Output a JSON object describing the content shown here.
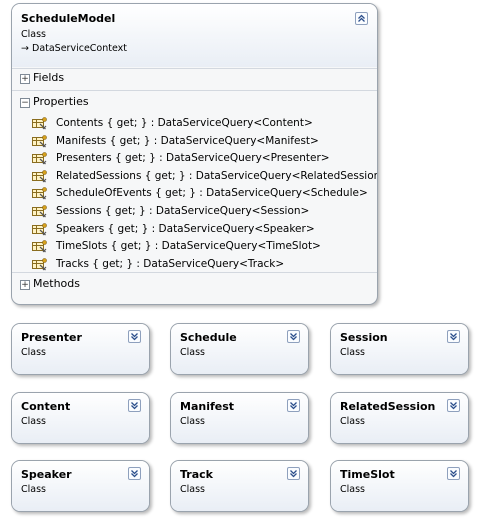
{
  "main_class": {
    "name": "ScheduleModel",
    "kind": "Class",
    "base": "DataServiceContext",
    "collapse_icon": "double-chevron-up-icon",
    "sections": {
      "fields": {
        "label": "Fields",
        "state": "collapsed"
      },
      "properties": {
        "label": "Properties",
        "state": "expanded"
      },
      "methods": {
        "label": "Methods",
        "state": "collapsed"
      }
    },
    "properties": [
      "Contents { get; } : DataServiceQuery<Content>",
      "Manifests { get; } : DataServiceQuery<Manifest>",
      "Presenters { get; } : DataServiceQuery<Presenter>",
      "RelatedSessions { get; } : DataServiceQuery<RelatedSession>",
      "ScheduleOfEvents { get; } : DataServiceQuery<Schedule>",
      "Sessions { get; } : DataServiceQuery<Session>",
      "Speakers { get; } : DataServiceQuery<Speaker>",
      "TimeSlots { get; } : DataServiceQuery<TimeSlot>",
      "Tracks { get; } : DataServiceQuery<Track>"
    ]
  },
  "classes": [
    {
      "name": "Presenter",
      "kind": "Class"
    },
    {
      "name": "Schedule",
      "kind": "Class"
    },
    {
      "name": "Session",
      "kind": "Class"
    },
    {
      "name": "Content",
      "kind": "Class"
    },
    {
      "name": "Manifest",
      "kind": "Class"
    },
    {
      "name": "RelatedSession",
      "kind": "Class"
    },
    {
      "name": "Speaker",
      "kind": "Class"
    },
    {
      "name": "Track",
      "kind": "Class"
    },
    {
      "name": "TimeSlot",
      "kind": "Class"
    }
  ],
  "colors": {
    "border": "#9aa3ad",
    "header_top": "#ffffff",
    "header_bottom": "#e9eef5",
    "toggle_border": "#8ea0bd"
  }
}
